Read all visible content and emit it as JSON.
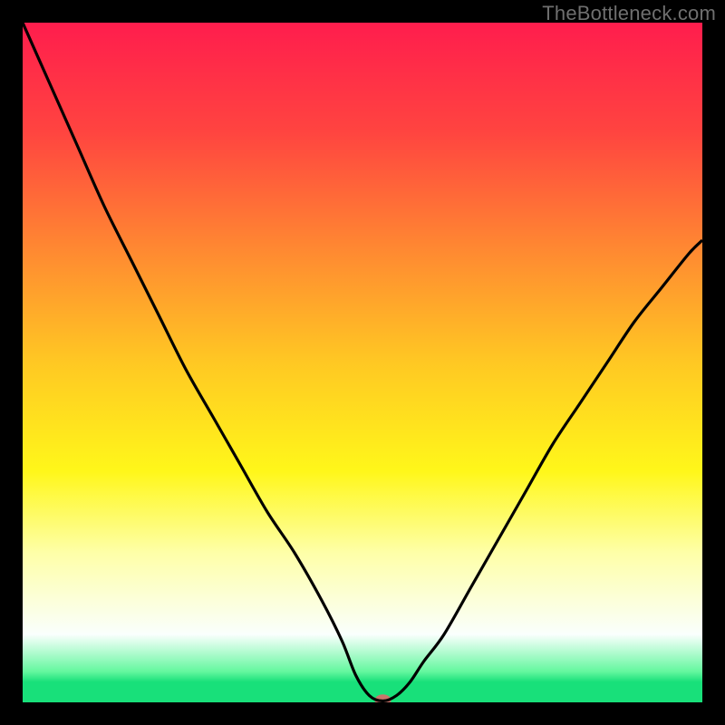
{
  "watermark": "TheBottleneck.com",
  "chart_data": {
    "type": "line",
    "title": "",
    "xlabel": "",
    "ylabel": "",
    "xlim": [
      0,
      100
    ],
    "ylim": [
      0,
      100
    ],
    "grid": false,
    "background_gradient": {
      "stops": [
        {
          "offset": 0.0,
          "color": "#ff1d4d"
        },
        {
          "offset": 0.16,
          "color": "#ff4440"
        },
        {
          "offset": 0.34,
          "color": "#ff8b31"
        },
        {
          "offset": 0.5,
          "color": "#ffc823"
        },
        {
          "offset": 0.66,
          "color": "#fff71a"
        },
        {
          "offset": 0.78,
          "color": "#feffa8"
        },
        {
          "offset": 0.9,
          "color": "#fafffd"
        },
        {
          "offset": 0.955,
          "color": "#63f79e"
        },
        {
          "offset": 0.97,
          "color": "#18e07a"
        },
        {
          "offset": 1.0,
          "color": "#18e07a"
        }
      ]
    },
    "series": [
      {
        "name": "bottleneck-curve",
        "x": [
          0,
          4,
          8,
          12,
          16,
          20,
          24,
          28,
          32,
          36,
          40,
          44,
          47,
          49,
          51,
          53,
          55,
          57,
          59,
          62,
          66,
          70,
          74,
          78,
          82,
          86,
          90,
          94,
          98,
          100
        ],
        "y": [
          100,
          91,
          82,
          73,
          65,
          57,
          49,
          42,
          35,
          28,
          22,
          15,
          9,
          4,
          1,
          0.2,
          1,
          3,
          6,
          10,
          17,
          24,
          31,
          38,
          44,
          50,
          56,
          61,
          66,
          68
        ]
      }
    ],
    "marker": {
      "name": "optimal-point",
      "x": 53,
      "y": 0.3,
      "rx": 9,
      "ry": 6.5,
      "color": "#c9756b"
    },
    "frame": {
      "color": "#000000",
      "thickness": 25
    }
  }
}
